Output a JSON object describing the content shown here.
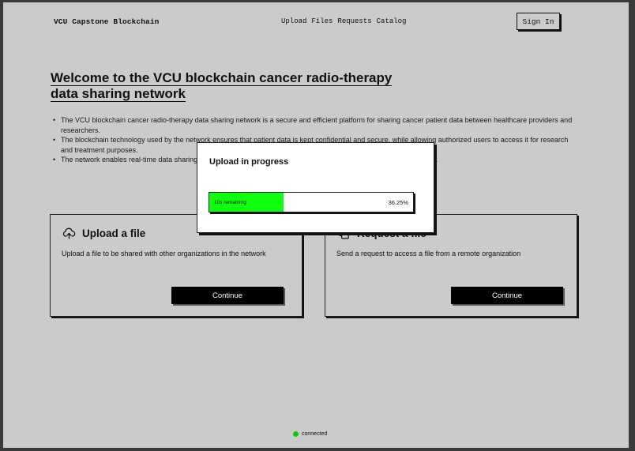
{
  "header": {
    "brand": "VCU Capstone Blockchain",
    "nav": [
      "Upload",
      "Files",
      "Requests",
      "Catalog"
    ],
    "sign_in": "Sign In"
  },
  "hero": {
    "title_line1": "Welcome to the VCU blockchain cancer radio-therapy",
    "title_line2": "data sharing network",
    "bullets": [
      "The VCU blockchain cancer radio-therapy data sharing network is a secure and efficient platform for sharing cancer patient data between healthcare providers and researchers.",
      "The blockchain technology used by the network ensures that patient data is kept confidential and secure, while allowing authorized users to access it for research and treatment purposes.",
      "The network enables real-time data sharing, which can lead to faster diagnoses and more personalized treatment plans."
    ]
  },
  "cards": {
    "upload": {
      "icon": "upload-cloud-icon",
      "title": "Upload a file",
      "description": "Upload a file to be shared with other organizations in the network",
      "button": "Continue"
    },
    "request": {
      "icon": "copy-document-icon",
      "title": "Request a file",
      "description": "Send a request to access a file from a remote organization",
      "button": "Continue"
    }
  },
  "modal": {
    "title": "Upload in progress",
    "remaining": "10s remaining",
    "percent_label": "36.25%",
    "progress": 0.3625,
    "fill_color": "#10ff10"
  },
  "status": {
    "label": "connected",
    "color": "#16c60c"
  }
}
